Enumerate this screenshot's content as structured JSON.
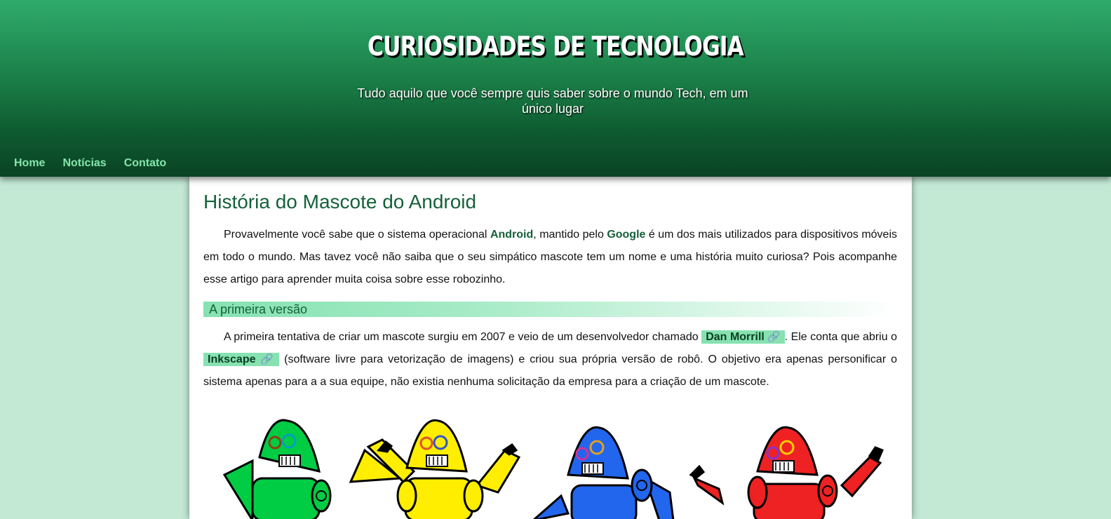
{
  "header": {
    "title": "CURIOSIDADES DE TECNOLOGIA",
    "subtitle": "Tudo aquilo que você sempre quis saber sobre o mundo Tech, em um único lugar"
  },
  "nav": {
    "items": [
      {
        "label": "Home"
      },
      {
        "label": "Notícias"
      },
      {
        "label": "Contato"
      }
    ]
  },
  "article": {
    "title": "História do Mascote do Android",
    "intro": {
      "t1": "Provavelmente você sabe que o sistema operacional ",
      "b1": "Android",
      "t2": ", mantido pelo ",
      "b2": "Google",
      "t3": " é um dos mais utilizados para dispositivos móveis em todo o mundo. Mas tavez você não saiba que o seu simpático mascote tem um nome e uma história muito curiosa? Pois acompanhe esse artigo para aprender muita coisa sobre esse robozinho."
    },
    "section1": {
      "heading": "A primeira versão",
      "t1": "A primeira tentativa de criar um mascote surgiu em 2007 e veio de um desenvolvedor chamado ",
      "link1": "Dan Morrill",
      "t2": ". Ele conta que abriu o ",
      "link2": "Inkscape",
      "t3": " (software livre para vetorização de imagens) e criou sua própria versão de robô. O objetivo era apenas personificar o sistema apenas para a a sua equipe, não existia nenhuma solicitação da empresa para a criação de um mascote."
    },
    "link_icon": "paperclip-icon",
    "robots_image": {
      "colors": [
        "#00cc44",
        "#ffee00",
        "#2266ee",
        "#ee2222"
      ]
    }
  },
  "colors": {
    "page_background": "#c3e9d5",
    "header_top": "#2fab6b",
    "header_bottom": "#0a4324",
    "nav_link": "#86e6ac",
    "accent_text": "#15613a",
    "highlight": "#86e2b1"
  }
}
